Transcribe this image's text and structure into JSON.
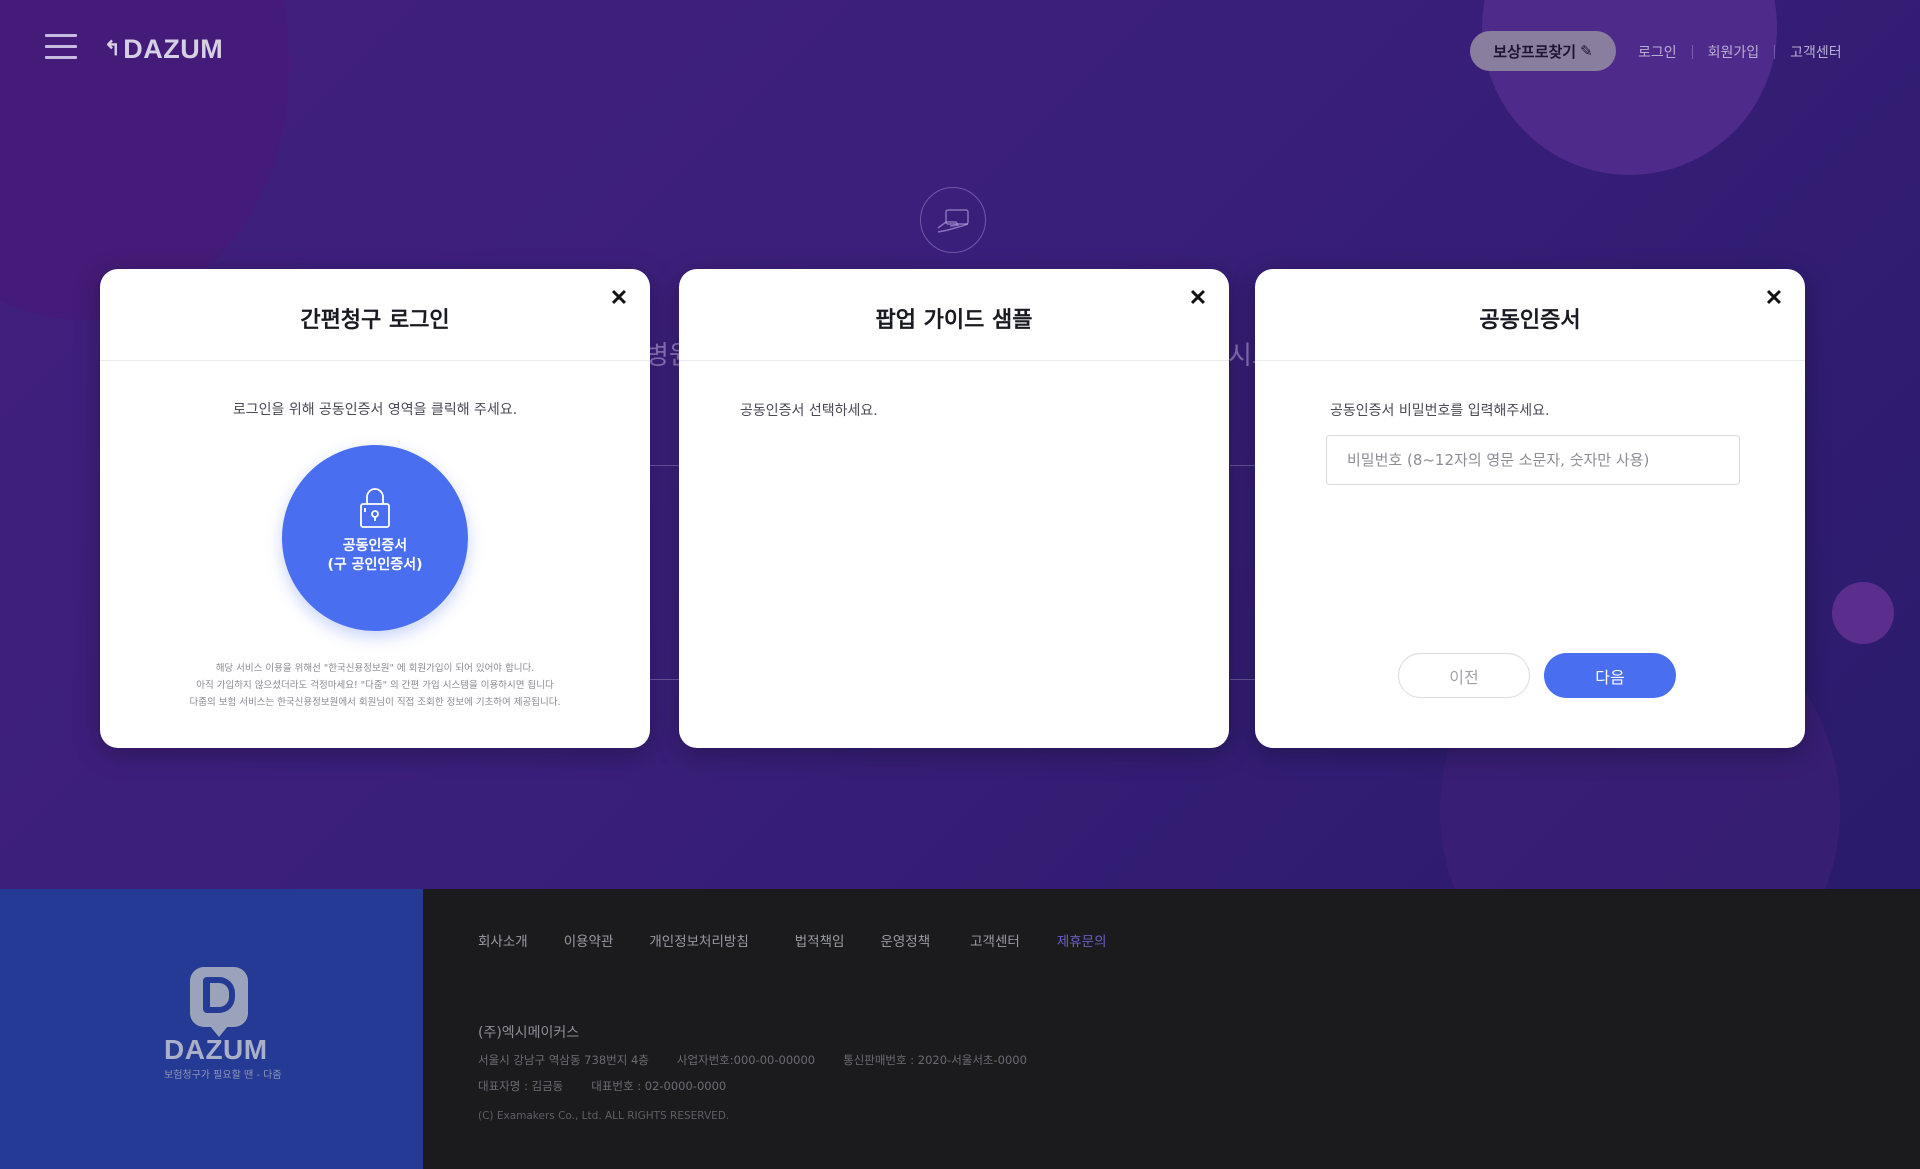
{
  "header": {
    "logo": "DAZUM",
    "find_button_label": "보상프로찾기",
    "nav_links": [
      "로그인",
      "회원가입",
      "고객센터"
    ]
  },
  "background": {
    "ghost_text_left": "병원",
    "ghost_text_right": "시요"
  },
  "modals": {
    "login": {
      "title": "간편청구 로그인",
      "message": "로그인을 위해 공동인증서 영역을 클릭해 주세요.",
      "cert_label_line1": "공동인증서",
      "cert_label_line2": "(구 공인인증서)",
      "notes": [
        "해당 서비스 이용을 위해선 \"한국신용정보원\" 에 회원가입이 되어 있어야 합니다.",
        "아직 가입하지 않으셨더라도 걱정마세요! \"다줌\" 의 간편 가입 시스템을 이용하시면 됩니다",
        "다줌의 보험 서비스는 한국신용정보원에서 회원님이 직접 조회한 정보에 기초하여 제공됩니다."
      ]
    },
    "guide": {
      "title": "팝업 가이드 샘플",
      "message": "공동인증서 선택하세요."
    },
    "cert": {
      "title": "공동인증서",
      "message": "공동인증서 비밀번호를 입력해주세요.",
      "password_placeholder": "비밀번호 (8~12자의 영문 소문자, 숫자만 사용)",
      "password_value": "",
      "prev_label": "이전",
      "next_label": "다음"
    }
  },
  "footer": {
    "logo": "DAZUM",
    "tagline": "보험청구가 필요할 땐 - 다줌",
    "links": [
      "회사소개",
      "이용약관",
      "개인정보처리방침",
      "법적책임",
      "운영정책",
      "고객센터",
      "제휴문의"
    ],
    "company": "(주)엑시메이커스",
    "address": "서울시 강남구 역삼동 738번지 4층",
    "business_no": "사업자번호:000-00-00000",
    "mail_order_no": "통신판매번호 : 2020-서울서초-0000",
    "ceo": "대표자명 : 김금동",
    "phone": "대표번호 : 02-0000-0000",
    "copyright": "(C) Examakers Co., Ltd. ALL RIGHTS RESERVED."
  },
  "colors": {
    "hero_bg": "#3a1f7a",
    "accent_blue": "#4a6ef0",
    "footer_left": "#253a94",
    "footer_right": "#1b1b1d",
    "find_button": "#8a7e9e"
  }
}
